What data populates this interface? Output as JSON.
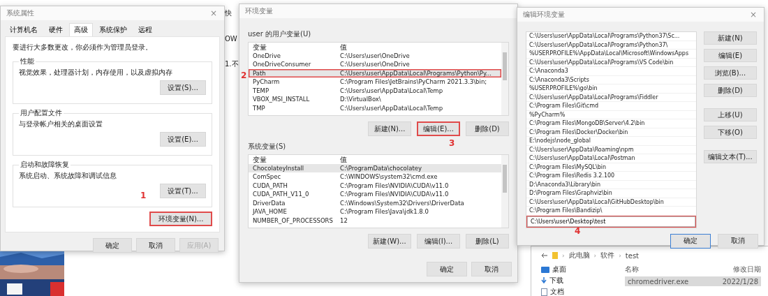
{
  "background_window": {
    "texts": [
      "快",
      "OW",
      "1.不"
    ]
  },
  "system_properties": {
    "title": "系统属性",
    "close": "×",
    "tabs": [
      {
        "label": "计算机名",
        "selected": false
      },
      {
        "label": "硬件",
        "selected": false
      },
      {
        "label": "高级",
        "selected": true
      },
      {
        "label": "系统保护",
        "selected": false
      },
      {
        "label": "远程",
        "selected": false
      }
    ],
    "note": "要进行大多数更改，你必须作为管理员登录。",
    "groups": [
      {
        "title": "性能",
        "description": "视觉效果，处理器计划，内存使用，以及虚拟内存",
        "button": "设置(S)..."
      },
      {
        "title": "用户配置文件",
        "description": "与登录帐户相关的桌面设置",
        "button": "设置(E)..."
      },
      {
        "title": "启动和故障恢复",
        "description": "系统启动、系统故障和调试信息",
        "button": "设置(T)..."
      }
    ],
    "env_button": {
      "label": "环境变量(N)...",
      "highlighted": true
    },
    "annotation": "1",
    "buttons": [
      {
        "label": "确定",
        "disabled": false
      },
      {
        "label": "取消",
        "disabled": false
      },
      {
        "label": "应用(A)",
        "disabled": true
      }
    ]
  },
  "environment_variables": {
    "title": "环境变量",
    "user_section": {
      "label": "user 的用户变量(U)",
      "columns": [
        "变量",
        "值"
      ],
      "rows": [
        {
          "name": "OneDrive",
          "value": "C:\\Users\\user\\OneDrive",
          "selected": false,
          "highlighted": false
        },
        {
          "name": "OneDriveConsumer",
          "value": "C:\\Users\\user\\OneDrive",
          "selected": false,
          "highlighted": false
        },
        {
          "name": "Path",
          "value": "C:\\Users\\user\\AppData\\Local\\Programs\\Python\\Py...",
          "selected": true,
          "highlighted": true
        },
        {
          "name": "PyCharm",
          "value": "C:\\Program Files\\JetBrains\\PyCharm 2021.3.3\\bin;",
          "selected": false,
          "highlighted": false
        },
        {
          "name": "TEMP",
          "value": "C:\\Users\\user\\AppData\\Local\\Temp",
          "selected": false,
          "highlighted": false
        },
        {
          "name": "VBOX_MSI_INSTALL",
          "value": "D:\\VirtualBox\\",
          "selected": false,
          "highlighted": false
        },
        {
          "name": "TMP",
          "value": "C:\\Users\\user\\AppData\\Local\\Temp",
          "selected": false,
          "highlighted": false
        }
      ],
      "buttons": [
        {
          "label": "新建(N)...",
          "highlighted": false
        },
        {
          "label": "编辑(E)...",
          "highlighted": true
        },
        {
          "label": "删除(D)",
          "highlighted": false
        }
      ]
    },
    "system_section": {
      "label": "系统变量(S)",
      "columns": [
        "变量",
        "值"
      ],
      "rows": [
        {
          "name": "ChocolateyInstall",
          "value": "C:\\ProgramData\\chocolatey",
          "selected": true,
          "highlighted": false
        },
        {
          "name": "ComSpec",
          "value": "C:\\WINDOWS\\system32\\cmd.exe",
          "selected": false,
          "highlighted": false
        },
        {
          "name": "CUDA_PATH",
          "value": "C:\\Program Files\\NVIDIA\\CUDA\\v11.0",
          "selected": false,
          "highlighted": false
        },
        {
          "name": "CUDA_PATH_V11_0",
          "value": "C:\\Program Files\\NVIDIA\\CUDA\\v11.0",
          "selected": false,
          "highlighted": false
        },
        {
          "name": "DriverData",
          "value": "C:\\Windows\\System32\\Drivers\\DriverData",
          "selected": false,
          "highlighted": false
        },
        {
          "name": "JAVA_HOME",
          "value": "C:\\Program Files\\Java\\jdk1.8.0",
          "selected": false,
          "highlighted": false
        },
        {
          "name": "NUMBER_OF_PROCESSORS",
          "value": "12",
          "selected": false,
          "highlighted": false
        }
      ],
      "buttons": [
        {
          "label": "新建(W)...",
          "highlighted": false
        },
        {
          "label": "编辑(I)...",
          "highlighted": false
        },
        {
          "label": "删除(L)",
          "highlighted": false
        }
      ]
    },
    "row_annotation": "2",
    "button_annotation": "3",
    "buttons": [
      {
        "label": "确定"
      },
      {
        "label": "取消"
      }
    ]
  },
  "edit_variable": {
    "title": "编辑环境变量",
    "close": "×",
    "entries": [
      {
        "text": "C:\\Users\\user\\AppData\\Local\\Programs\\Python37\\Sc...",
        "kind": "entry"
      },
      {
        "text": "C:\\Users\\user\\AppData\\Local\\Programs\\Python37\\",
        "kind": "entry"
      },
      {
        "text": "%USERPROFILE%\\AppData\\Local\\Microsoft\\WindowsApps",
        "kind": "entry"
      },
      {
        "text": "C:\\Users\\user\\AppData\\Local\\Programs\\VS Code\\bin",
        "kind": "entry"
      },
      {
        "text": "C:\\Anaconda3",
        "kind": "entry"
      },
      {
        "text": "C:\\Anaconda3\\Scripts",
        "kind": "entry"
      },
      {
        "text": "%USERPROFILE%\\go\\bin",
        "kind": "entry"
      },
      {
        "text": "C:\\Users\\user\\AppData\\Local\\Programs\\Fiddler",
        "kind": "entry"
      },
      {
        "text": "C:\\Program Files\\Git\\cmd",
        "kind": "entry"
      },
      {
        "text": "%PyCharm%",
        "kind": "entry"
      },
      {
        "text": "C:\\Program Files\\MongoDB\\Server\\4.2\\bin",
        "kind": "entry"
      },
      {
        "text": "C:\\Program Files\\Docker\\Docker\\bin",
        "kind": "entry"
      },
      {
        "text": "E:\\nodejs\\node_global",
        "kind": "entry"
      },
      {
        "text": "C:\\Users\\user\\AppData\\Roaming\\npm",
        "kind": "entry"
      },
      {
        "text": "C:\\Users\\user\\AppData\\Local\\Postman",
        "kind": "entry"
      },
      {
        "text": "C:\\Program Files\\MySQL\\bin",
        "kind": "entry"
      },
      {
        "text": "C:\\Program Files\\Redis 3.2.100",
        "kind": "entry"
      },
      {
        "text": "D:\\Anaconda3\\Library\\bin",
        "kind": "entry"
      },
      {
        "text": "D:\\Program Files\\Graphviz\\bin",
        "kind": "entry"
      },
      {
        "text": "C:\\Users\\user\\AppData\\Local\\GitHubDesktop\\bin",
        "kind": "entry"
      },
      {
        "text": "C:\\Program Files\\Bandizip\\",
        "kind": "entry"
      },
      {
        "text": "C:\\Users\\user\\Desktop\\test",
        "kind": "editing"
      }
    ],
    "side_button_groups": [
      {
        "buttons": [
          "新建(N)",
          "编辑(E)",
          "浏览(B)...",
          "删除(D)"
        ]
      },
      {
        "buttons": [
          "上移(U)",
          "下移(O)"
        ]
      },
      {
        "buttons": [
          "编辑文本(T)..."
        ]
      }
    ],
    "annotation": "4",
    "buttons": [
      {
        "label": "确定",
        "default": true
      },
      {
        "label": "取消",
        "default": false
      }
    ]
  },
  "explorer": {
    "breadcrumb": [
      {
        "separator": "›",
        "label": "此电脑"
      },
      {
        "separator": "›",
        "label": "软件"
      },
      {
        "separator": "›",
        "label": "test"
      }
    ],
    "sidebar": [
      {
        "label": "桌面",
        "kind": "desktop"
      },
      {
        "label": "下载",
        "kind": "download"
      },
      {
        "label": "文档",
        "kind": "documents"
      }
    ],
    "columns": [
      "名称",
      "修改日期"
    ],
    "files": [
      {
        "name": "chromedriver.exe",
        "date": "2022/1/28",
        "selected": true
      }
    ]
  }
}
